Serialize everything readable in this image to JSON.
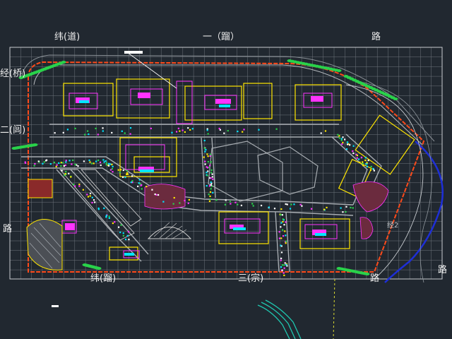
{
  "drawing": {
    "road_labels": {
      "top_left": "纬(道)",
      "top_middle": "一（蹓）",
      "top_right": "路",
      "left_upper": "经(桥)",
      "left_middle": "二(闾)",
      "left_lower": "路",
      "bottom_left": "纬(蹓)",
      "bottom_middle": "三(宗)",
      "bottom_right": "路",
      "right_edge": "路",
      "right_road": "经2"
    },
    "colors": {
      "background": "#212830",
      "grid": "#8f969c",
      "boundary": "#ff4a1a",
      "road": "#a7acb1",
      "building_yellow": "#ffe600",
      "magenta": "#ff33ff",
      "cyan": "#00e5ff",
      "green": "#29d24a",
      "blue_road": "#1e2fd6",
      "plaza": "#6b2b3e",
      "white": "#ffffff",
      "text": "#eeeeee"
    }
  }
}
